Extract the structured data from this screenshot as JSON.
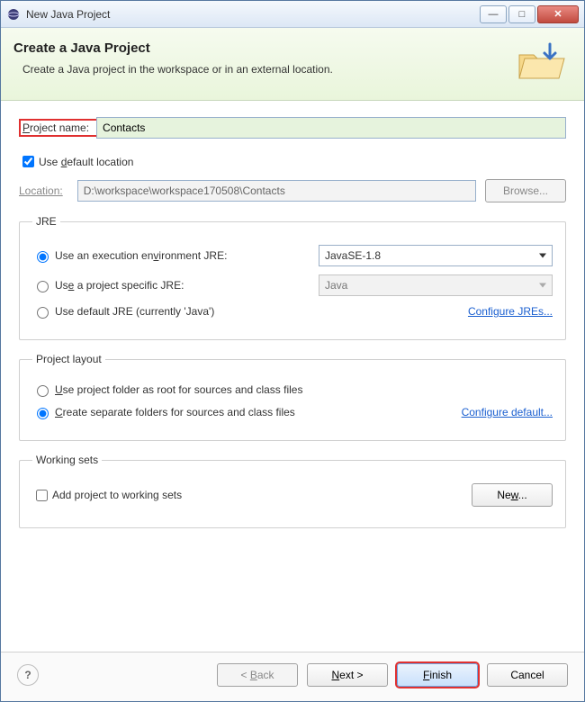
{
  "titlebar": {
    "title": "New Java Project"
  },
  "header": {
    "title": "Create a Java Project",
    "subtitle": "Create a Java project in the workspace or in an external location."
  },
  "project": {
    "name_label_pre": "P",
    "name_label_post": "roject name:",
    "name_value": "Contacts",
    "use_default_label": "Use default location",
    "use_default_mn": "d",
    "location_label": "Location:",
    "location_value": "D:\\workspace\\workspace170508\\Contacts",
    "browse_label": "Browse..."
  },
  "jre": {
    "legend": "JRE",
    "opt1_pre": "Use an execution en",
    "opt1_mn": "v",
    "opt1_post": "ironment JRE:",
    "opt1_value": "JavaSE-1.8",
    "opt2_pre": "Us",
    "opt2_mn": "e",
    "opt2_post": " a project specific JRE:",
    "opt2_value": "Java",
    "opt3": "Use default JRE (currently 'Java')",
    "configure": "Configure JREs..."
  },
  "layout": {
    "legend": "Project layout",
    "opt1_mn": "U",
    "opt1_post": "se project folder as root for sources and class files",
    "opt2_mn": "C",
    "opt2_post": "reate separate folders for sources and class files",
    "configure": "Configure default..."
  },
  "workingsets": {
    "legend": "Working sets",
    "add_label": "Add project to working sets",
    "new_label": "New..."
  },
  "footer": {
    "back": "< Back",
    "next": "Next >",
    "finish": "Finish",
    "cancel": "Cancel"
  }
}
